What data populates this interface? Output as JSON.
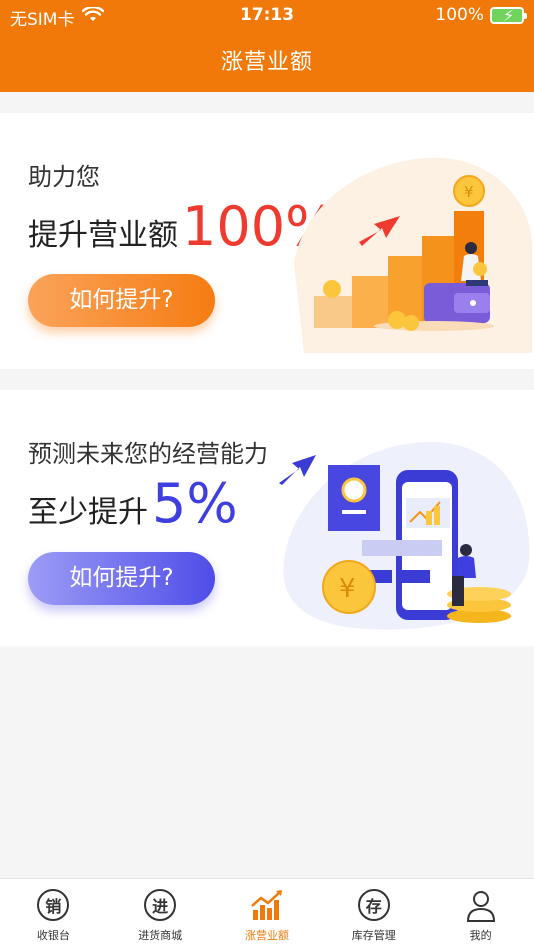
{
  "status_bar": {
    "carrier": "无SIM卡",
    "time": "17:13",
    "battery": "100%"
  },
  "nav": {
    "title": "涨营业额"
  },
  "cards": [
    {
      "subtitle": "助力您",
      "main_text": "提升营业额",
      "highlight": "100%",
      "button": "如何提升?",
      "coin_symbol": "¥",
      "accent_color": "#ef3b2f"
    },
    {
      "subtitle": "预测未来您的经营能力",
      "main_text": "至少提升",
      "highlight": "5%",
      "button": "如何提升?",
      "coin_symbol": "¥",
      "accent_color": "#3f3fe0"
    }
  ],
  "tabbar": {
    "items": [
      {
        "label": "收银台",
        "icon_char": "销",
        "icon": "cashier-icon",
        "active": false
      },
      {
        "label": "进货商城",
        "icon_char": "进",
        "icon": "purchase-mall-icon",
        "active": false
      },
      {
        "label": "涨营业额",
        "icon": "revenue-chart-icon",
        "active": true
      },
      {
        "label": "库存管理",
        "icon_char": "存",
        "icon": "inventory-icon",
        "active": false
      },
      {
        "label": "我的",
        "icon": "user-icon",
        "active": false
      }
    ]
  },
  "colors": {
    "brand": "#f1790a",
    "header_bg": "#f1790a",
    "red_accent": "#ef3b2f",
    "blue_accent": "#3f3fe0"
  }
}
